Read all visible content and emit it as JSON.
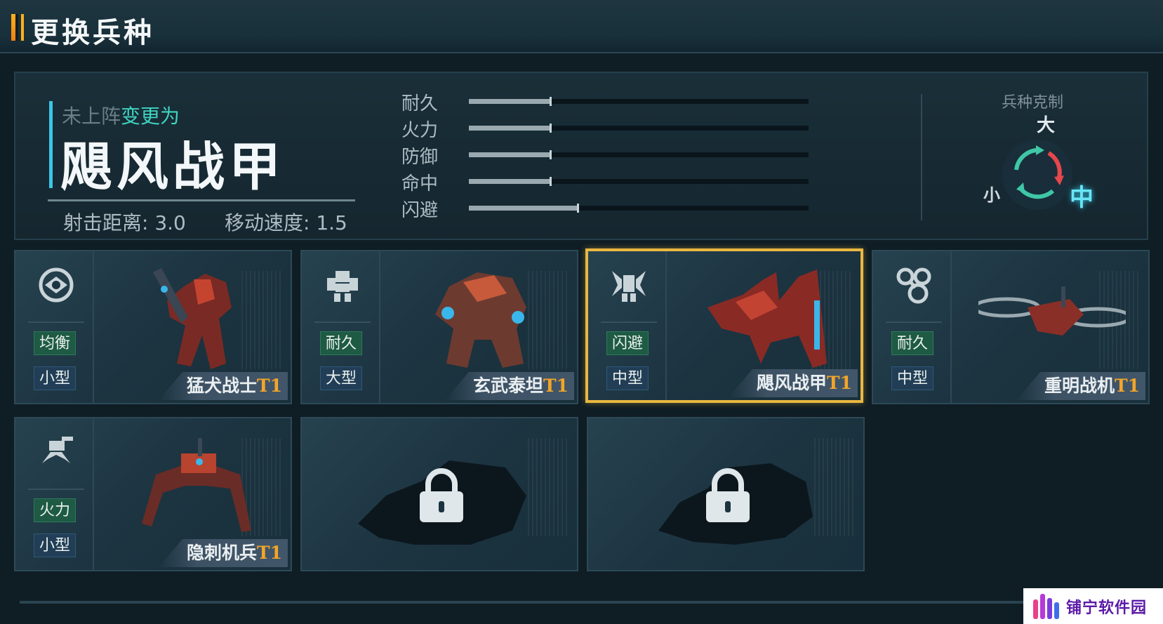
{
  "header": {
    "title": "更换兵种"
  },
  "selected": {
    "status_prefix": "未上阵",
    "status_action": "变更为",
    "name": "飓风战甲",
    "range_label": "射击距离: 3.0",
    "speed_label": "移动速度: 1.5"
  },
  "stats": [
    {
      "label": "耐久",
      "fraction": 0.24
    },
    {
      "label": "火力",
      "fraction": 0.24
    },
    {
      "label": "防御",
      "fraction": 0.24
    },
    {
      "label": "命中",
      "fraction": 0.24
    },
    {
      "label": "闪避",
      "fraction": 0.32
    }
  ],
  "counter": {
    "title": "兵种克制",
    "large": "大",
    "small": "小",
    "medium": "中"
  },
  "units": [
    {
      "name": "猛犬战士",
      "tier": "T1",
      "role": "均衡",
      "size": "小型",
      "icon": "balance-icon",
      "locked": false,
      "selected": false
    },
    {
      "name": "玄武泰坦",
      "tier": "T1",
      "role": "耐久",
      "size": "大型",
      "icon": "endurance-mech-icon",
      "locked": false,
      "selected": false
    },
    {
      "name": "飓风战甲",
      "tier": "T1",
      "role": "闪避",
      "size": "中型",
      "icon": "evasion-mech-icon",
      "locked": false,
      "selected": true
    },
    {
      "name": "重明战机",
      "tier": "T1",
      "role": "耐久",
      "size": "中型",
      "icon": "aircraft-icon",
      "locked": false,
      "selected": false
    },
    {
      "name": "隐刺机兵",
      "tier": "T1",
      "role": "火力",
      "size": "小型",
      "icon": "spider-mech-icon",
      "locked": false,
      "selected": false
    },
    {
      "locked": true,
      "icon": "lock-icon"
    },
    {
      "locked": true,
      "icon": "lock-icon"
    }
  ],
  "watermark": {
    "text": "铺宁软件园",
    "colors": [
      "#e9408a",
      "#b53ad6",
      "#7a3bdc",
      "#3f6ee8"
    ]
  },
  "colors": {
    "accent_gold": "#e9b741",
    "teal": "#3fd4c0",
    "tier": "#f2a52a",
    "cyan": "#6ae5f5"
  }
}
